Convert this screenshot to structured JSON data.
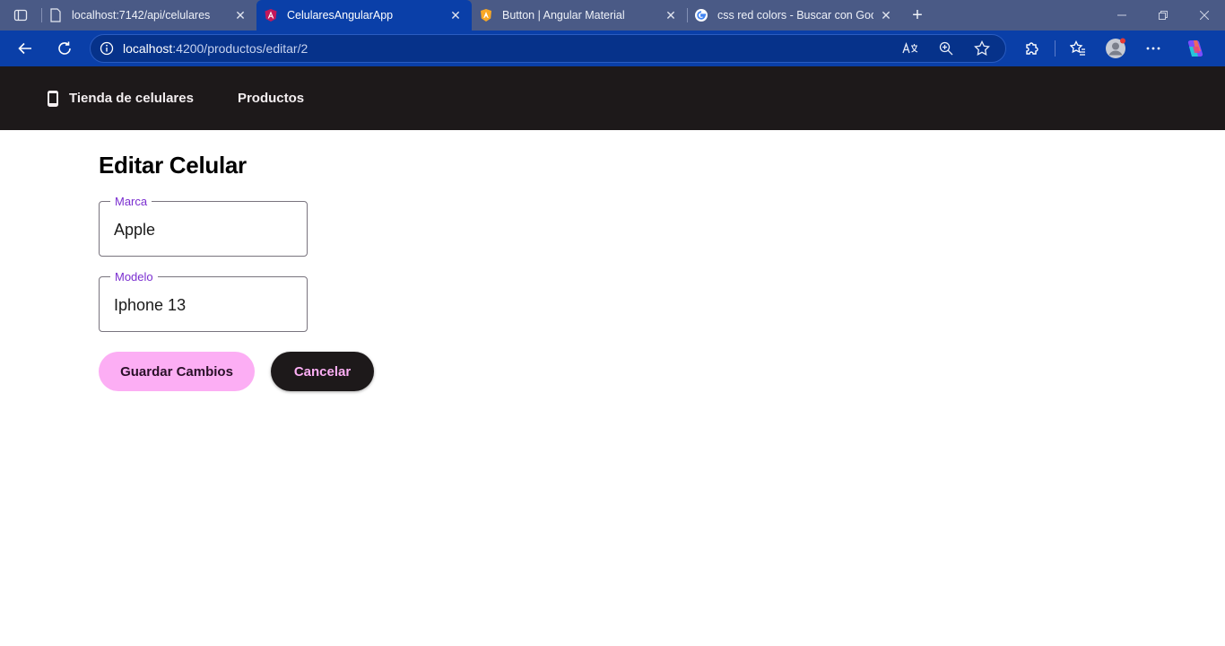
{
  "browser": {
    "tabs": [
      {
        "title": "localhost:7142/api/celulares",
        "favicon": "page-icon",
        "active": false
      },
      {
        "title": "CelularesAngularApp",
        "favicon": "angular-icon",
        "active": true
      },
      {
        "title": "Button | Angular Material",
        "favicon": "angular-material-icon",
        "active": false
      },
      {
        "title": "css red colors - Buscar con Googl",
        "favicon": "google-icon",
        "active": false
      }
    ],
    "close_glyph": "✕",
    "new_tab_glyph": "+",
    "address": {
      "host": "localhost",
      "path": ":4200/productos/editar/2"
    }
  },
  "app": {
    "brand": "Tienda de celulares",
    "nav": {
      "productos": "Productos"
    },
    "page_title": "Editar Celular",
    "form": {
      "marca": {
        "label": "Marca",
        "value": "Apple"
      },
      "modelo": {
        "label": "Modelo",
        "value": "Iphone 13"
      }
    },
    "buttons": {
      "save": "Guardar Cambios",
      "cancel": "Cancelar"
    }
  },
  "colors": {
    "browser_frame": "#4a5a86",
    "browser_active": "#0a3fa8",
    "app_header": "#1d191a",
    "accent_pink": "#fcaef4",
    "label_purple": "#7b2fd0"
  }
}
